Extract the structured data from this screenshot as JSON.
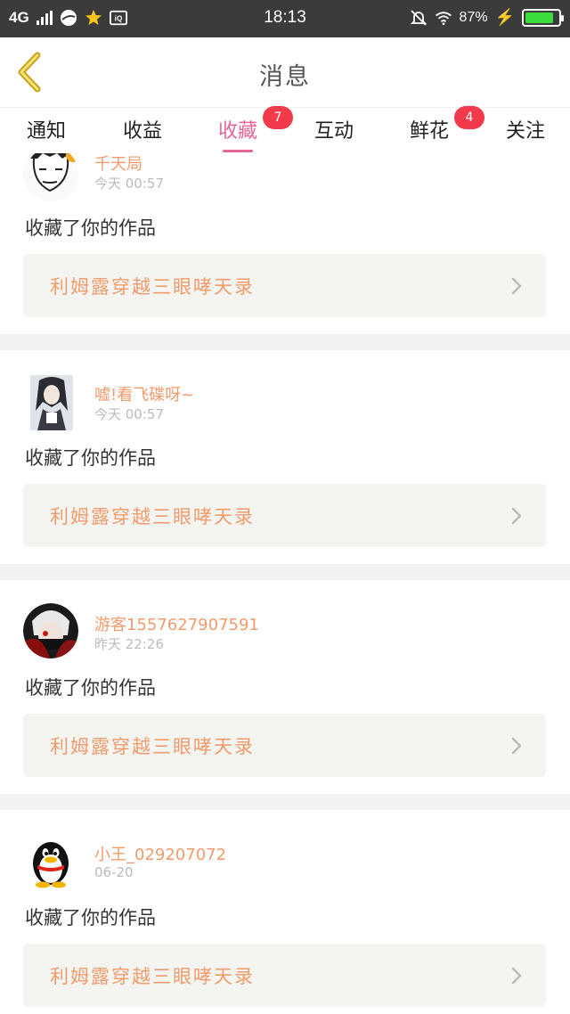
{
  "status_bar": {
    "network": "4G",
    "time": "18:13",
    "battery_percent": "87%",
    "battery_level": 0.87,
    "icons": [
      "signal-icon",
      "app-circle-icon",
      "star-icon",
      "iqiyi-icon",
      "mute-icon",
      "wifi-icon",
      "charging-icon",
      "battery-icon"
    ]
  },
  "header": {
    "title": "消息",
    "back_icon": "chevron-left-icon"
  },
  "tabs": [
    {
      "label": "通知",
      "badge": null,
      "active": false
    },
    {
      "label": "收益",
      "badge": null,
      "active": false
    },
    {
      "label": "收藏",
      "badge": "7",
      "active": true
    },
    {
      "label": "互动",
      "badge": null,
      "active": false
    },
    {
      "label": "鲜花",
      "badge": "4",
      "active": false
    },
    {
      "label": "关注",
      "badge": null,
      "active": false
    }
  ],
  "colors": {
    "accent": "#e7669a",
    "badge": "#f33a4b",
    "username": "#f29b6c",
    "work_title": "#f29b6c",
    "work_box_bg": "#f4f4f0",
    "status_bar_bg": "#3b3b3b"
  },
  "feed": [
    {
      "user_name": "千天局",
      "time": "今天 00:57",
      "action": "收藏了你的作品",
      "work_title": "利姆露穿越三眼哮天录",
      "avatar": "sketch-face-avatar"
    },
    {
      "user_name": "嘘!看飞碟呀~",
      "time": "今天 00:57",
      "action": "收藏了你的作品",
      "work_title": "利姆露穿越三眼哮天录",
      "avatar": "anime-girl-avatar"
    },
    {
      "user_name": "游客1557627907591",
      "time": "昨天 22:26",
      "action": "收藏了你的作品",
      "work_title": "利姆露穿越三眼哮天录",
      "avatar": "tokyo-ghoul-avatar"
    },
    {
      "user_name": "小王_029207072",
      "time": "06-20",
      "action": "收藏了你的作品",
      "work_title": "利姆露穿越三眼哮天录",
      "avatar": "qq-penguin-avatar"
    }
  ]
}
